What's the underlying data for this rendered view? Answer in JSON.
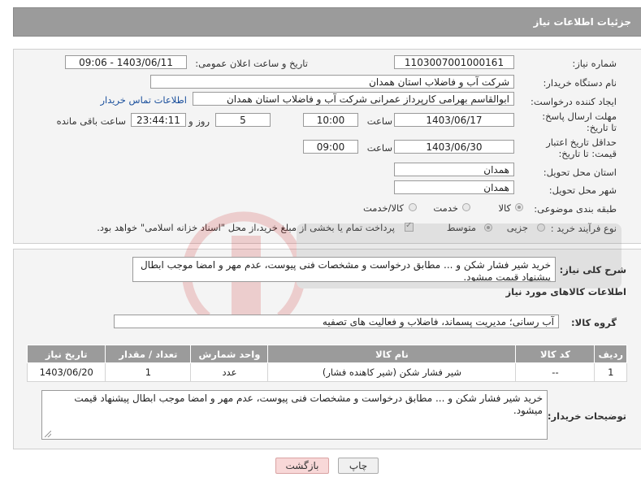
{
  "header": {
    "title": "جزئیات اطلاعات نیاز"
  },
  "form": {
    "need_number_label": "شماره نیاز:",
    "need_number": "1103007001000161",
    "announce_label": "تاریخ و ساعت اعلان عمومی:",
    "announce_value": "1403/06/11 - 09:06",
    "buyer_org_label": "نام دستگاه خریدار:",
    "buyer_org": "شرکت آب و فاضلاب استان همدان",
    "creator_label": "ایجاد کننده درخواست:",
    "creator": "ابوالقاسم بهرامی کارپرداز عمرانی شرکت آب و فاضلاب استان همدان",
    "contact_link": "اطلاعات تماس خریدار",
    "reply_deadline_label": "مهلت ارسال پاسخ: تا تاریخ:",
    "reply_date": "1403/06/17",
    "time_label": "ساعت",
    "reply_time": "10:00",
    "days_value": "5",
    "days_label": "روز و",
    "remaining_time": "23:44:11",
    "remaining_label": "ساعت باقی مانده",
    "validity_label": "حداقل تاریخ اعتبار قیمت: تا تاریخ:",
    "validity_date": "1403/06/30",
    "validity_time": "09:00",
    "province_label": "استان محل تحویل:",
    "province": "همدان",
    "city_label": "شهر محل تحویل:",
    "city": "همدان",
    "category_label": "طبقه بندی موضوعی:",
    "category_options": [
      "کالا",
      "خدمت",
      "کالا/خدمت"
    ],
    "process_label": "نوع فرآیند خرید :",
    "process_options": [
      "جزیی",
      "متوسط"
    ],
    "payment_note": "پرداخت تمام یا بخشی از مبلغ خرید،از محل \"اسناد خزانه اسلامی\" خواهد بود."
  },
  "details": {
    "summary_label": "شرح کلی نیاز:",
    "summary": "خرید شیر فشار شکن و ... مطابق درخواست و مشخصات فنی پیوست، عدم مهر و امضا موجب ابطال پیشنهاد قیمت میشود.",
    "goods_info_title": "اطلاعات کالاهای مورد نیاز",
    "goods_group_label": "گروه کالا:",
    "goods_group": "آب رسانی؛ مدیریت پسماند، فاضلاب و فعالیت های تصفیه",
    "table_headers": [
      "ردیف",
      "کد کالا",
      "نام کالا",
      "واحد شمارش",
      "تعداد / مقدار",
      "تاریخ نیاز"
    ],
    "table_rows": [
      [
        "1",
        "--",
        "شیر فشار شکن (شیر کاهنده فشار)",
        "عدد",
        "1",
        "1403/06/20"
      ]
    ],
    "buyer_notes_label": "توضیحات خریدار:",
    "buyer_notes": "خرید شیر فشار شکن و ... مطابق درخواست و مشخصات فنی پیوست، عدم مهر و امضا موجب ابطال پیشنهاد قیمت میشود."
  },
  "buttons": {
    "print": "چاپ",
    "back": "بازگشت"
  },
  "colors": {
    "header_bg": "#9b9b9b",
    "link": "#1a4f9c",
    "back_button": "#f8d8d8"
  }
}
